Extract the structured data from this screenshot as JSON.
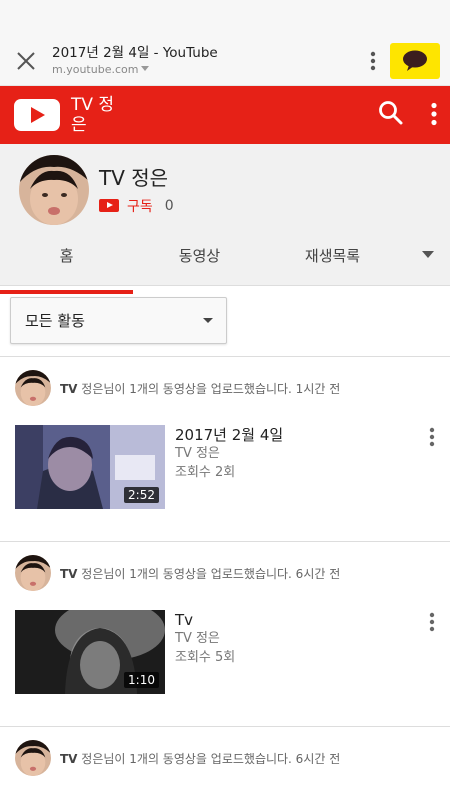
{
  "browser": {
    "page_title": "2017년 2월 4일 - YouTube",
    "host": "m.youtube.com",
    "close_icon": "close-icon",
    "menu_icon": "more-vert-icon",
    "share_icon": "kakaotalk-icon"
  },
  "header": {
    "title": "TV 정은",
    "logo_icon": "youtube-logo-icon",
    "search_icon": "search-icon",
    "menu_icon": "more-vert-icon"
  },
  "channel": {
    "name": "TV 정은",
    "subscribe_label": "구독",
    "subscriber_count": "0"
  },
  "tabs": [
    {
      "label": "홈",
      "active": true
    },
    {
      "label": "동영상",
      "active": false
    },
    {
      "label": "재생목록",
      "active": false
    }
  ],
  "filter": {
    "selected": "모든 활동"
  },
  "feed": [
    {
      "channel_name": "TV",
      "activity": " 정은님이 1개의 동영상을 업로드했습니다. 1시간 전",
      "video": {
        "title": "2017년 2월 4일",
        "channel": "TV 정은",
        "views": "조회수 2회",
        "duration": "2:52"
      }
    },
    {
      "channel_name": "TV",
      "activity": " 정은님이 1개의 동영상을 업로드했습니다. 6시간 전",
      "video": {
        "title": "Tv",
        "channel": "TV 정은",
        "views": "조회수 5회",
        "duration": "1:10"
      }
    },
    {
      "channel_name": "TV",
      "activity": " 정은님이 1개의 동영상을 업로드했습니다. 6시간 전"
    }
  ],
  "colors": {
    "brand": "#e62117",
    "kakao": "#fee500"
  }
}
